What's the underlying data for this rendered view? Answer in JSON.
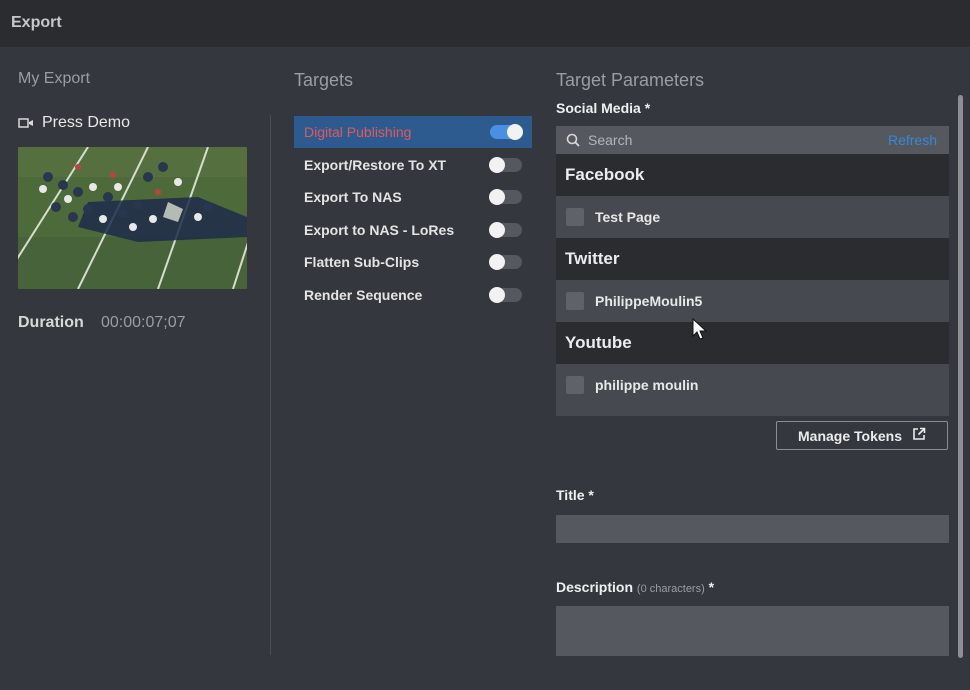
{
  "window": {
    "title": "Export"
  },
  "my_export": {
    "heading": "My Export",
    "clip_name": "Press Demo",
    "duration_label": "Duration",
    "duration_value": "00:00:07;07"
  },
  "targets": {
    "heading": "Targets",
    "items": [
      {
        "label": "Digital Publishing",
        "enabled": true,
        "selected": true
      },
      {
        "label": "Export/Restore To XT",
        "enabled": false
      },
      {
        "label": "Export To NAS",
        "enabled": false
      },
      {
        "label": "Export to NAS - LoRes",
        "enabled": false
      },
      {
        "label": "Flatten Sub-Clips",
        "enabled": false
      },
      {
        "label": "Render Sequence",
        "enabled": false
      }
    ]
  },
  "parameters": {
    "heading": "Target Parameters",
    "social_media": {
      "label": "Social Media *",
      "search_placeholder": "Search",
      "refresh_label": "Refresh",
      "groups": [
        {
          "name": "Facebook",
          "accounts": [
            {
              "name": "Test Page",
              "checked": false
            }
          ]
        },
        {
          "name": "Twitter",
          "accounts": [
            {
              "name": "PhilippeMoulin5",
              "checked": false
            }
          ]
        },
        {
          "name": "Youtube",
          "accounts": [
            {
              "name": "philippe moulin",
              "checked": false
            }
          ]
        }
      ],
      "manage_tokens_label": "Manage Tokens"
    },
    "title_label": "Title *",
    "description_label": "Description",
    "description_hint": "(0 characters)",
    "description_required": "*"
  },
  "colors": {
    "background": "#34373d",
    "titlebar": "#2a2c30",
    "accent": "#4a90e2",
    "selected_target": "#2d5a8f",
    "selected_text": "#e05a5a",
    "refresh": "#3b86d6"
  }
}
